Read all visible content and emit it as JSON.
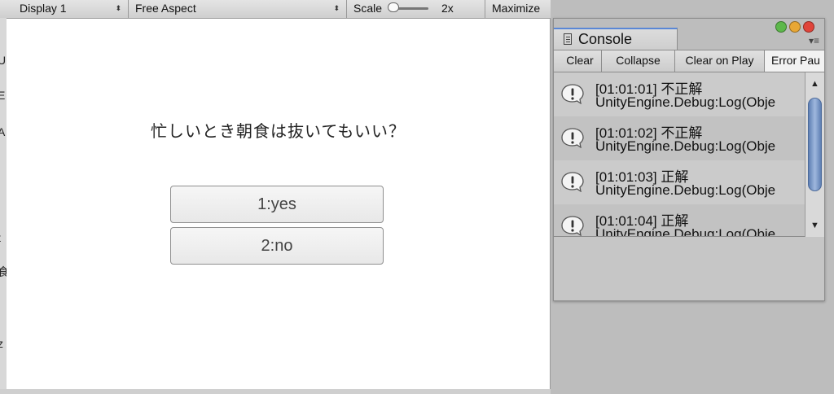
{
  "toolbar": {
    "display": "Display 1",
    "aspect": "Free Aspect",
    "scale_label": "Scale",
    "scale_value": "2x",
    "maximize": "Maximize",
    "spinner_glyph": "⬍"
  },
  "left_strip_glyphs": [
    "U",
    "E",
    "A",
    "!",
    "t",
    "食",
    "z"
  ],
  "game": {
    "question": "忙しいとき朝食は抜いてもいい？",
    "answers": [
      "1:yes",
      "2:no"
    ]
  },
  "console": {
    "title": "Console",
    "buttons": [
      "Clear",
      "Collapse",
      "Clear on Play",
      "Error Pau"
    ],
    "logs": [
      {
        "line1": "[01:01:01] 不正解",
        "line2": "UnityEngine.Debug:Log(Obje"
      },
      {
        "line1": "[01:01:02] 不正解",
        "line2": "UnityEngine.Debug:Log(Obje"
      },
      {
        "line1": "[01:01:03] 正解",
        "line2": "UnityEngine.Debug:Log(Obje"
      },
      {
        "line1": "[01:01:04] 正解",
        "line2": "UnityEngine.Debug:Log(Obje"
      }
    ],
    "menu_glyph": "▾≡",
    "scroll_up_glyph": "▲",
    "scroll_down_glyph": "▼",
    "icons": {
      "log": "info-bubble-icon"
    },
    "colors": {
      "close": "#e0443a",
      "minimize": "#e8a735",
      "zoom": "#5db84b",
      "accent": "#5a87d6"
    }
  }
}
